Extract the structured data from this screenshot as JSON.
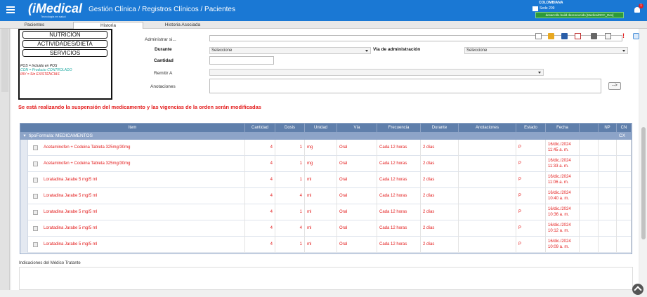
{
  "app": {
    "logo": "iMedical",
    "logo_subtitle": "Tecnología en salud",
    "breadcrumb": "Gestión Clínica / Registros Clínicos / Pacientes",
    "country": "COLOMBIANA",
    "sede": "Sede 209",
    "build_badge": "desarrollo build desconocido [MedicalOCC_Dev]",
    "notification_count": "1"
  },
  "tabs": [
    "Pacientes",
    "Historia",
    "Historia Asociada"
  ],
  "legend": {
    "buttons": [
      "NUTRICION",
      "ACTIVIDADES/DIETA",
      "SERVICIOS"
    ],
    "lines": [
      {
        "text": "POS = Incluido en POS",
        "color": "#111111"
      },
      {
        "text": "CON = Producto CONTROLADO",
        "color": "#19a8a0"
      },
      {
        "text": "INV = Sin EXISTENCIAS",
        "color": "#e31b1b"
      }
    ]
  },
  "form": {
    "administrar_label": "Administrar si...",
    "durante_label": "Durante",
    "durante_value": "Seleccione",
    "via_label": "Vía de administración",
    "via_value": "Seleccione",
    "cantidad_label": "Cantidad",
    "remitir_label": "Remitir A",
    "anotaciones_label": "Anotaciones",
    "arrow_button": "-->"
  },
  "warning": "Se está realizando la suspensión del medicamento y las vigencias de la orden serán modificadas",
  "grid": {
    "headers": [
      "Item",
      "Cantidad",
      "Dosis",
      "Unidad",
      "Vía",
      "Frecuencia",
      "Durante",
      "Anotaciones",
      "Estado",
      "Fecha",
      "NP",
      "CN",
      "CX"
    ],
    "group_label": "tipoFormula: MEDICAMENTOS",
    "rows": [
      {
        "item": "Acetaminofen + Codeina Tableta 325mg/30mg",
        "cantidad": "4",
        "dosis": "1",
        "unidad": "mg",
        "via": "Oral",
        "frecuencia": "Cada 12 horas",
        "durante": "2 días",
        "anotaciones": "",
        "estado": "P",
        "fecha1": "16/dic./2024",
        "fecha2": "11:45 a. m."
      },
      {
        "item": "Acetaminofen + Codeina Tableta 325mg/30mg",
        "cantidad": "4",
        "dosis": "1",
        "unidad": "mg",
        "via": "Oral",
        "frecuencia": "Cada 12 horas",
        "durante": "2 días",
        "anotaciones": "",
        "estado": "P",
        "fecha1": "16/dic./2024",
        "fecha2": "11:33 a. m."
      },
      {
        "item": "Loratadina Jarabe 5 mg/5 ml",
        "cantidad": "4",
        "dosis": "1",
        "unidad": "ml",
        "via": "Oral",
        "frecuencia": "Cada 12 horas",
        "durante": "2 días",
        "anotaciones": "",
        "estado": "P",
        "fecha1": "16/dic./2024",
        "fecha2": "11:06 a. m."
      },
      {
        "item": "Loratadina Jarabe 5 mg/5 ml",
        "cantidad": "4",
        "dosis": "4",
        "unidad": "ml",
        "via": "Oral",
        "frecuencia": "Cada 12 horas",
        "durante": "2 días",
        "anotaciones": "",
        "estado": "P",
        "fecha1": "16/dic./2024",
        "fecha2": "10:40 a. m."
      },
      {
        "item": "Loratadina Jarabe 5 mg/5 ml",
        "cantidad": "4",
        "dosis": "1",
        "unidad": "ml",
        "via": "Oral",
        "frecuencia": "Cada 12 horas",
        "durante": "2 días",
        "anotaciones": "",
        "estado": "P",
        "fecha1": "16/dic./2024",
        "fecha2": "10:36 a. m."
      },
      {
        "item": "Loratadina Jarabe 5 mg/5 ml",
        "cantidad": "4",
        "dosis": "4",
        "unidad": "ml",
        "via": "Oral",
        "frecuencia": "Cada 12 horas",
        "durante": "2 días",
        "anotaciones": "",
        "estado": "P",
        "fecha1": "16/dic./2024",
        "fecha2": "10:12 a. m."
      },
      {
        "item": "Loratadina Jarabe 5 mg/5 ml",
        "cantidad": "4",
        "dosis": "1",
        "unidad": "ml",
        "via": "Oral",
        "frecuencia": "Cada 12 horas",
        "durante": "2 días",
        "anotaciones": "",
        "estado": "P",
        "fecha1": "16/dic./2024",
        "fecha2": "10:09 a. m."
      }
    ]
  },
  "indicaciones_label": "Indicaciones del Médico Tratante",
  "toolbar_icons": [
    "new-document-icon",
    "open-folder-icon",
    "save-icon",
    "export-excel-icon",
    "print-icon",
    "preview-icon",
    "alert-icon",
    "chat-icon"
  ],
  "colors": {
    "topbar": "#1a78d4",
    "grid_header": "#5f7fab",
    "warning": "#e31b1b"
  }
}
